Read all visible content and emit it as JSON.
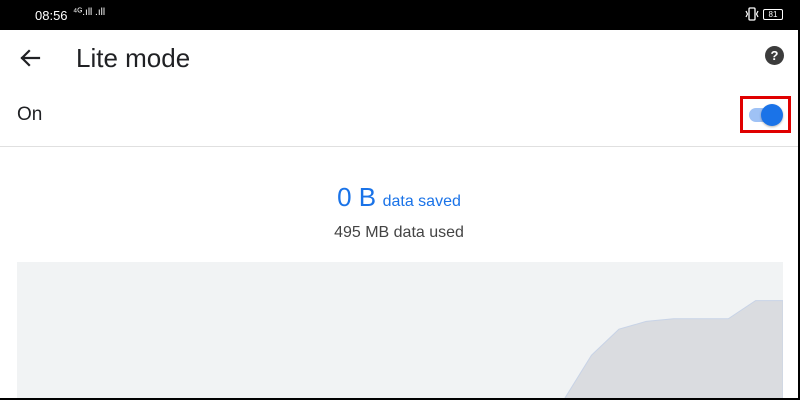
{
  "status_bar": {
    "time": "08:56",
    "signal_text": "⁴ᴳ.ıll .ıll",
    "vibrate_icon": "vibrate-icon",
    "battery_level": "81"
  },
  "app_bar": {
    "title": "Lite mode",
    "back_icon": "arrow-back-icon",
    "help_icon": "help-icon",
    "help_glyph": "?"
  },
  "toggle": {
    "label": "On",
    "state": "on",
    "accent_color": "#1a73e8"
  },
  "summary": {
    "saved_amount": "0 B",
    "saved_label": "data saved",
    "used_text": "495 MB data used"
  },
  "chart_data": {
    "type": "area",
    "title": "",
    "xlabel": "",
    "ylabel": "",
    "series": [
      {
        "values": [
          0,
          0,
          0,
          0,
          0,
          0,
          0,
          0,
          0,
          0,
          0,
          0,
          0,
          0,
          0,
          0,
          0,
          0,
          0,
          0,
          0.02,
          0.36,
          0.56,
          0.62,
          0.64,
          0.64,
          0.64,
          0.78,
          0.78
        ]
      }
    ],
    "ylim": [
      0,
      1
    ]
  }
}
